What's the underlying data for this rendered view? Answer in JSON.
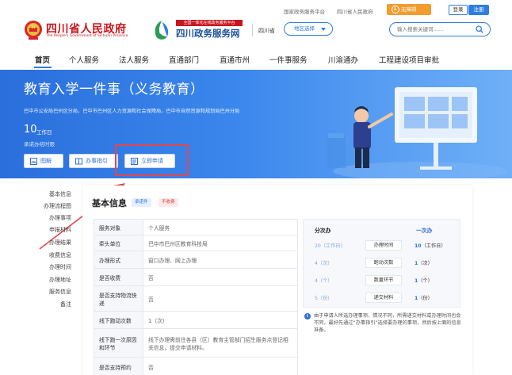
{
  "top_bar": {
    "links": [
      "国家政务服务平台",
      "四川省人民政府"
    ],
    "accessibility": "无障碍",
    "login": "登录",
    "register": "注册"
  },
  "header": {
    "gov_name": "四川省人民政府",
    "gov_name_en": "The People's Government of Sichuan Province",
    "platform_badge": "全国一体化在线政务服务平台",
    "platform_name": "四川政务服务网",
    "province": "四川省",
    "region_button": "地区选择",
    "search_placeholder": "输入搜索关键词……"
  },
  "nav": {
    "items": [
      "首页",
      "个人服务",
      "法人服务",
      "直通部门",
      "直通市州",
      "一件事服务",
      "川渝通办",
      "工程建设项目审批"
    ]
  },
  "banner": {
    "title": "教育入学一件事（义务教育）",
    "departments": "巴中市公安局巴州区分局，巴中市巴州区人力资源和社会保障局，巴中市自然资源和规划局巴州分局",
    "days_value": "10",
    "days_unit": "工作日",
    "days_label": "承诺办结时限",
    "buttons": [
      "图解",
      "办事指引",
      "立即申请"
    ]
  },
  "side_menu": {
    "items": [
      "基本信息",
      "办理流程图",
      "办理事项",
      "申报材料",
      "办理结果",
      "收费信息",
      "办理时间",
      "办理地址",
      "服务信息",
      "备注"
    ]
  },
  "basic_info": {
    "title": "基本信息",
    "tags": [
      "承诺件",
      "不收费"
    ],
    "rows": [
      {
        "key": "服务对象",
        "value": "个人服务"
      },
      {
        "key": "牵头单位",
        "value": "巴中市巴州区教育科技局"
      },
      {
        "key": "办理形式",
        "value": "窗口办理、网上办理"
      },
      {
        "key": "是否收费",
        "value": "否"
      },
      {
        "key": "是否支持物流快递",
        "value": "否"
      },
      {
        "key": "线下跑动次数",
        "value": "1（次）"
      },
      {
        "key": "线下跑一次原因和环节",
        "value": "线下办理需前往各县（区）教育主管部门招生服务点登记相关信息，提交申请材料。"
      },
      {
        "key": "是否支持预约",
        "value": "否"
      }
    ]
  },
  "comparison": {
    "header_left": "分次办",
    "header_right": "一次办",
    "rows": [
      {
        "left": "20（工作日）",
        "label": "办理时间",
        "right_num": "10",
        "right_unit": "（工作日）"
      },
      {
        "left": "4（次）",
        "label": "跑动次数",
        "right_num": "1",
        "right_unit": "（次）"
      },
      {
        "left": "4（个）",
        "label": "数量环节",
        "right_num": "1",
        "right_unit": "（个）"
      },
      {
        "left": "5（份）",
        "label": "递交材料",
        "right_num": "1",
        "right_unit": "（份）"
      }
    ],
    "note": "由于申请人所选办理事项、情况不同，所需递交材料或办理时间也会不同，最好先通过“办事指引”选择要办理的事项，然后按上面的信息准备。"
  },
  "colors": {
    "brand_blue": "#2f7de1",
    "gov_red": "#c8161d",
    "highlight_red": "#e0484a",
    "access_orange": "#f29b2f"
  }
}
